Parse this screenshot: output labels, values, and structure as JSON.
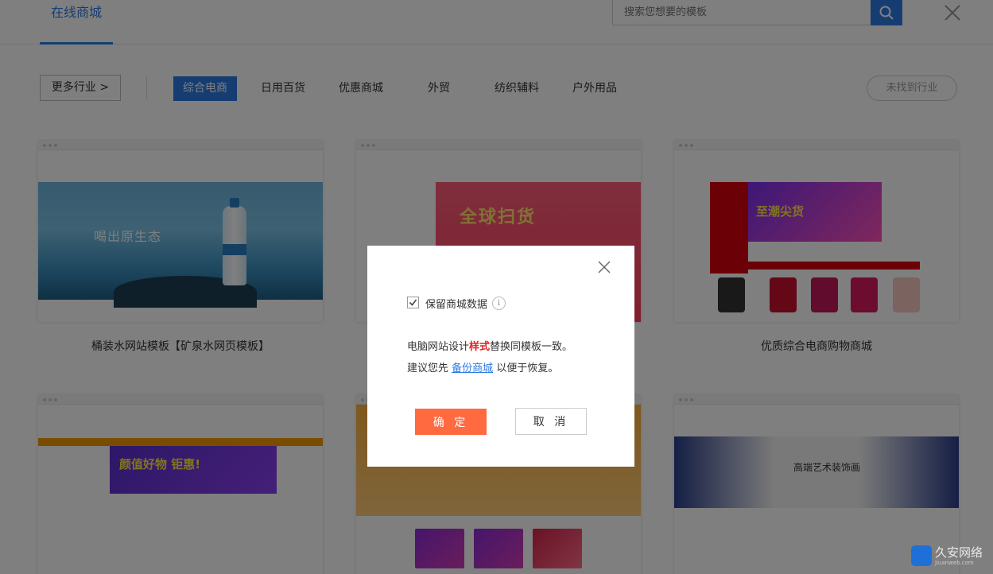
{
  "header": {
    "active_tab": "在线商城",
    "search_placeholder": "搜索您想要的模板"
  },
  "filters": {
    "more_label": "更多行业 >",
    "categories": [
      "综合电商",
      "日用百货",
      "优惠商城",
      "外贸",
      "纺织辅料",
      "户外用品"
    ],
    "active_category": "综合电商",
    "not_found_label": "未找到行业"
  },
  "cards": [
    {
      "title": "桶装水网站模板【矿泉水网页模板】",
      "slogan": "喝出原生态"
    },
    {
      "title": "",
      "slogan": "全球扫货"
    },
    {
      "title": "优质综合电商购物商城",
      "slogan": "至潮尖货"
    },
    {
      "title": "",
      "slogan": "颜值好物 钜惠!"
    },
    {
      "title": "",
      "slogan": ""
    },
    {
      "title": "",
      "slogan": "高端艺术装饰画"
    }
  ],
  "dialog": {
    "checkbox_label": "保留商城数据",
    "checkbox_checked": true,
    "info_icon": "i",
    "line1_prefix": "电脑网站设计",
    "line1_highlight": "样式",
    "line1_suffix": "替换同模板一致。",
    "line2_prefix": "建议您先",
    "line2_link": "备份商城",
    "line2_suffix": "以便于恢复。",
    "confirm_label": "确 定",
    "cancel_label": "取 消"
  },
  "watermark": {
    "text": "久安网络",
    "sub": "jiuanweb.com"
  },
  "colors": {
    "accent": "#2c7be5",
    "confirm": "#ff6a40",
    "highlight": "#e02020"
  }
}
